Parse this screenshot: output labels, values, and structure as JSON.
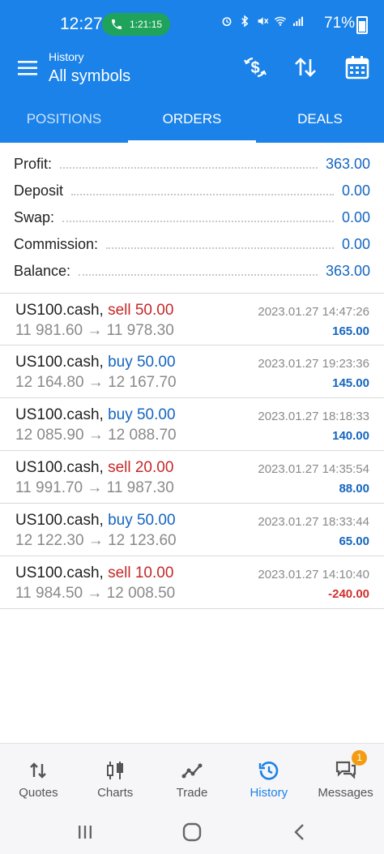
{
  "status_bar": {
    "time": "12:27",
    "call_duration": "1:21:15",
    "battery": "71%"
  },
  "app_bar": {
    "subtitle": "History",
    "title": "All symbols"
  },
  "tabs": [
    {
      "label": "POSITIONS",
      "active": false
    },
    {
      "label": "ORDERS",
      "active": true
    },
    {
      "label": "DEALS",
      "active": false
    }
  ],
  "summary": [
    {
      "label": "Profit:",
      "value": "363.00"
    },
    {
      "label": "Deposit",
      "value": "0.00"
    },
    {
      "label": "Swap:",
      "value": "0.00"
    },
    {
      "label": "Commission:",
      "value": "0.00"
    },
    {
      "label": "Balance:",
      "value": "363.00"
    }
  ],
  "deals": [
    {
      "symbol": "US100.cash,",
      "side": "sell 50.00",
      "prices": "11 981.60 → 11 978.30",
      "time": "2023.01.27 14:47:26",
      "profit": "165.00",
      "type": "sell",
      "sign": "pos"
    },
    {
      "symbol": "US100.cash,",
      "side": "buy 50.00",
      "prices": "12 164.80 → 12 167.70",
      "time": "2023.01.27 19:23:36",
      "profit": "145.00",
      "type": "buy",
      "sign": "pos"
    },
    {
      "symbol": "US100.cash,",
      "side": "buy 50.00",
      "prices": "12 085.90 → 12 088.70",
      "time": "2023.01.27 18:18:33",
      "profit": "140.00",
      "type": "buy",
      "sign": "pos"
    },
    {
      "symbol": "US100.cash,",
      "side": "sell 20.00",
      "prices": "11 991.70 → 11 987.30",
      "time": "2023.01.27 14:35:54",
      "profit": "88.00",
      "type": "sell",
      "sign": "pos"
    },
    {
      "symbol": "US100.cash,",
      "side": "buy 50.00",
      "prices": "12 122.30 → 12 123.60",
      "time": "2023.01.27 18:33:44",
      "profit": "65.00",
      "type": "buy",
      "sign": "pos"
    },
    {
      "symbol": "US100.cash,",
      "side": "sell 10.00",
      "prices": "11 984.50 → 12 008.50",
      "time": "2023.01.27 14:10:40",
      "profit": "-240.00",
      "type": "sell",
      "sign": "neg"
    }
  ],
  "bottom_nav": [
    {
      "label": "Quotes",
      "icon": "quotes-icon",
      "active": false
    },
    {
      "label": "Charts",
      "icon": "charts-icon",
      "active": false
    },
    {
      "label": "Trade",
      "icon": "trade-icon",
      "active": false
    },
    {
      "label": "History",
      "icon": "history-icon",
      "active": true
    },
    {
      "label": "Messages",
      "icon": "messages-icon",
      "active": false,
      "badge": "1"
    }
  ],
  "colors": {
    "primary": "#1a82e8",
    "sell": "#c62828",
    "buy": "#1565c0",
    "negative": "#d32f2f"
  }
}
